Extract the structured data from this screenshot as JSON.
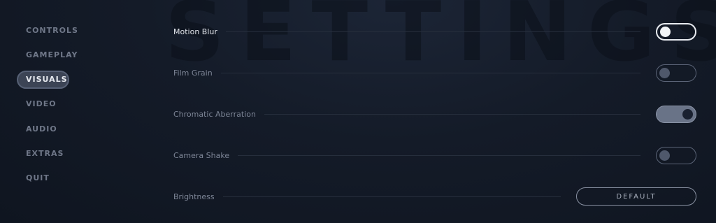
{
  "watermark": "SETTINGS",
  "sidebar": {
    "items": [
      {
        "label": "CONTROLS",
        "active": false
      },
      {
        "label": "GAMEPLAY",
        "active": false
      },
      {
        "label": "VISUALS",
        "active": true
      },
      {
        "label": "VIDEO",
        "active": false
      },
      {
        "label": "AUDIO",
        "active": false
      },
      {
        "label": "EXTRAS",
        "active": false
      },
      {
        "label": "QUIT",
        "active": false
      }
    ]
  },
  "settings": {
    "motion_blur": {
      "label": "Motion Blur",
      "state": "off",
      "focused": true
    },
    "film_grain": {
      "label": "Film Grain",
      "state": "off"
    },
    "chromatic_aberration": {
      "label": "Chromatic Aberration",
      "state": "on"
    },
    "camera_shake": {
      "label": "Camera Shake",
      "state": "off"
    },
    "brightness": {
      "label": "Brightness",
      "default_label": "DEFAULT"
    }
  },
  "colors": {
    "background": "#141b28",
    "active_item": "#3c4455",
    "toggle_on": "#697387",
    "focus": "#e8ebf0"
  }
}
